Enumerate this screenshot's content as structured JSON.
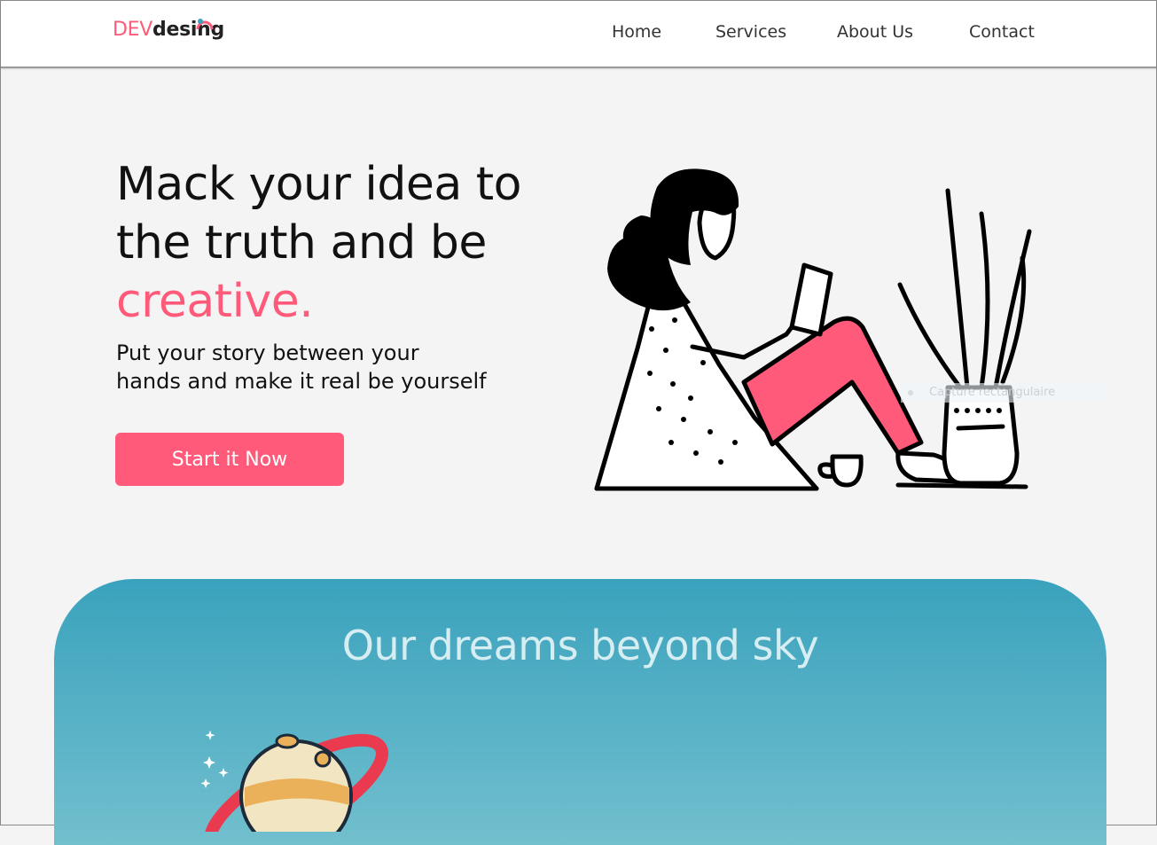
{
  "brand": {
    "part1": "DEV",
    "part2": "desing"
  },
  "nav": {
    "items": [
      {
        "label": "Home"
      },
      {
        "label": "Services"
      },
      {
        "label": "About Us"
      },
      {
        "label": "Contact"
      }
    ]
  },
  "hero": {
    "title_line1": "Mack your idea to",
    "title_line2": "the truth and be",
    "title_accent": "creative.",
    "subtitle": "Put your story between your hands and make it real be yourself",
    "cta_label": "Start it Now"
  },
  "overlay": {
    "text": "Capture rectangulaire"
  },
  "section_sky": {
    "title": "Our dreams beyond sky"
  },
  "colors": {
    "accent": "#ff5a79",
    "sky_top": "#3aa2bd",
    "sky_bottom": "#72bfce",
    "text": "#111111"
  },
  "icons": [
    "logo-mark-icon",
    "reading-woman-illustration",
    "planet-illustration"
  ]
}
